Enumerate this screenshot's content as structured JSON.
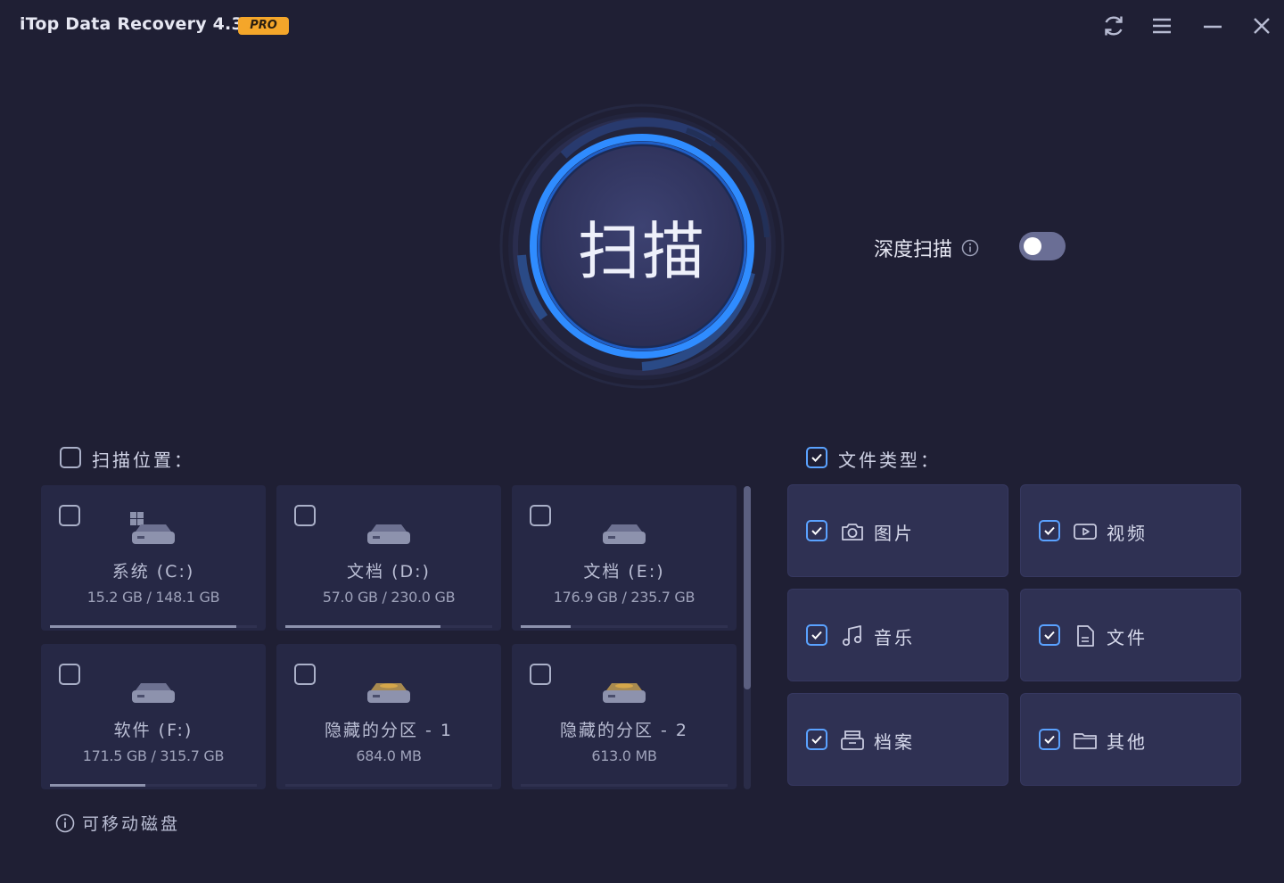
{
  "app": {
    "title": "iTop Data Recovery 4.3",
    "badge": "PRO"
  },
  "titlebar": {
    "buttons": [
      {
        "name": "refresh-icon"
      },
      {
        "name": "menu-icon"
      },
      {
        "name": "minimize-icon"
      },
      {
        "name": "close-icon"
      }
    ]
  },
  "scan": {
    "label": "扫描"
  },
  "deep_scan": {
    "label": "深度扫描",
    "enabled": false
  },
  "scan_location": {
    "label": "扫描位置：",
    "checked": false
  },
  "drives": [
    {
      "name": "系统 (C:)",
      "size": "15.2 GB / 148.1 GB",
      "used_fraction": 0.9,
      "icon": "system-drive-icon",
      "checked": false
    },
    {
      "name": "文档 (D:)",
      "size": "57.0 GB / 230.0 GB",
      "used_fraction": 0.75,
      "icon": "drive-icon",
      "checked": false
    },
    {
      "name": "文档 (E:)",
      "size": "176.9 GB / 235.7 GB",
      "used_fraction": 0.24,
      "icon": "drive-icon",
      "checked": false
    },
    {
      "name": "软件 (F:)",
      "size": "171.5 GB / 315.7 GB",
      "used_fraction": 0.46,
      "icon": "drive-icon",
      "checked": false
    },
    {
      "name": "隐藏的分区 - 1",
      "size": "684.0 MB",
      "used_fraction": 0,
      "icon": "hidden-partition-icon",
      "checked": false
    },
    {
      "name": "隐藏的分区 - 2",
      "size": "613.0 MB",
      "used_fraction": 0,
      "icon": "hidden-partition-icon",
      "checked": false
    }
  ],
  "removable": {
    "label": "可移动磁盘"
  },
  "file_types": {
    "label": "文件类型：",
    "checked": true,
    "items": [
      {
        "label": "图片",
        "icon": "camera-icon",
        "checked": true
      },
      {
        "label": "视频",
        "icon": "video-icon",
        "checked": true
      },
      {
        "label": "音乐",
        "icon": "music-icon",
        "checked": true
      },
      {
        "label": "文件",
        "icon": "document-icon",
        "checked": true
      },
      {
        "label": "档案",
        "icon": "archive-icon",
        "checked": true
      },
      {
        "label": "其他",
        "icon": "folder-icon",
        "checked": true
      }
    ]
  },
  "colors": {
    "accent": "#2f8cff",
    "background": "#1f1f34",
    "badge": "#f4a62a"
  }
}
